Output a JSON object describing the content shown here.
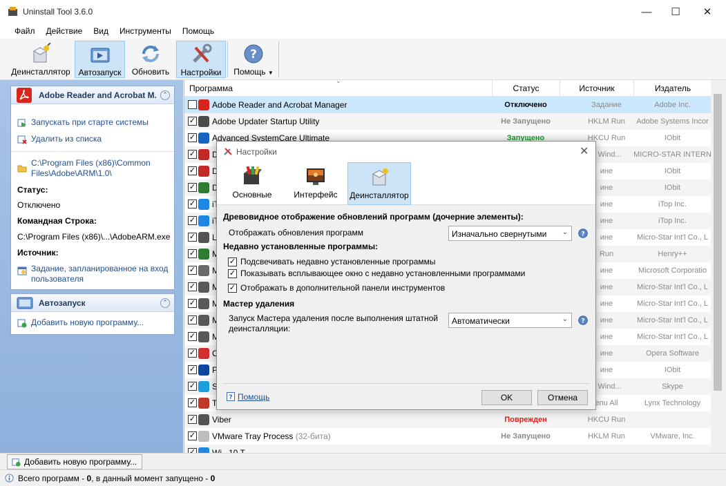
{
  "window": {
    "title": "Uninstall Tool 3.6.0"
  },
  "menu": [
    "Файл",
    "Действие",
    "Вид",
    "Инструменты",
    "Помощь"
  ],
  "toolbar": {
    "uninstaller": "Деинсталлятор",
    "autorun": "Автозапуск",
    "refresh": "Обновить",
    "settings": "Настройки",
    "help": "Помощь"
  },
  "left_panel": {
    "card1": {
      "title": "Adobe Reader and Acrobat M...",
      "run_at_startup": "Запускать при старте системы",
      "remove_from_list": "Удалить из списка",
      "path_line1": "C:\\Program Files (x86)\\Common",
      "path_line2": "Files\\Adobe\\ARM\\1.0\\",
      "status_label": "Статус:",
      "status_value": "Отключено",
      "cmd_label": "Командная Строка:",
      "cmd_value": "C:\\Program Files (x86)\\...\\AdobeARM.exe",
      "source_label": "Источник:",
      "source_line1": "Задание, запланированное на вход",
      "source_line2": "пользователя"
    },
    "card2": {
      "title": "Автозапуск",
      "add_new": "Добавить новую программу..."
    }
  },
  "grid": {
    "headers": {
      "program": "Программа",
      "status": "Статус",
      "source": "Источник",
      "publisher": "Издатель"
    },
    "rows": [
      {
        "name": "Adobe Reader and Acrobat Manager",
        "status": "Отключено",
        "source": "Задание",
        "publisher": "Adobe Inc."
      },
      {
        "name": "Adobe Updater Startup Utility",
        "status": "Не Запущено",
        "source": "HKLM Run",
        "publisher": "Adobe Systems Incor"
      },
      {
        "name": "Advanced SystemCare Ultimate",
        "status": "Запущено",
        "source": "HKCU Run",
        "publisher": "IObit"
      },
      {
        "name": "D",
        "status": "",
        "source": "a Wind...",
        "publisher": "MICRO-STAR INTERN"
      },
      {
        "name": "D",
        "status": "",
        "source": "ине",
        "publisher": "IObit"
      },
      {
        "name": "D",
        "status": "",
        "source": "ине",
        "publisher": "IObit"
      },
      {
        "name": "iT",
        "status": "",
        "source": "ине",
        "publisher": "iTop Inc."
      },
      {
        "name": "iT",
        "status": "",
        "source": "ине",
        "publisher": "iTop Inc."
      },
      {
        "name": "L",
        "status": "",
        "source": "ине",
        "publisher": "Micro-Star Int'l Co., L"
      },
      {
        "name": "M",
        "status": "",
        "source": "Run",
        "publisher": "Henry++"
      },
      {
        "name": "M",
        "status": "",
        "source": "ине",
        "publisher": "Microsoft Corporatio"
      },
      {
        "name": "M",
        "status": "",
        "source": "ине",
        "publisher": "Micro-Star Int'l Co., L"
      },
      {
        "name": "M",
        "status": "",
        "source": "ине",
        "publisher": "Micro-Star Int'l Co., L"
      },
      {
        "name": "M",
        "status": "",
        "source": "ине",
        "publisher": "Micro-Star Int'l Co., L"
      },
      {
        "name": "M",
        "status": "",
        "source": "ине",
        "publisher": "Micro-Star Int'l Co., L"
      },
      {
        "name": "O",
        "status": "",
        "source": "ине",
        "publisher": "Opera Software"
      },
      {
        "name": "P",
        "status": "",
        "source": "ине",
        "publisher": "IObit"
      },
      {
        "name": "S",
        "status": "",
        "source": "a Wind...",
        "publisher": "Skype"
      },
      {
        "name": "T",
        "status": "",
        "source": "еnu All",
        "publisher": "Lynx Technology"
      },
      {
        "name": "Viber",
        "status": "Поврежден",
        "source": "HKCU Run",
        "publisher": ""
      },
      {
        "name": "VMware Tray Process",
        "suffix": "(32-бита)",
        "status": "Не Запущено",
        "source": "HKLM Run",
        "publisher": "VMware, Inc."
      },
      {
        "name": "Wi...10 T...",
        "status": "",
        "source": "",
        "publisher": ""
      }
    ]
  },
  "bottom": {
    "add_button": "Добавить новую программу...",
    "status_prefix": "Всего программ - ",
    "total": "0",
    "status_middle": ", в данный момент запущено - ",
    "running": "0"
  },
  "dialog": {
    "title": "Настройки",
    "tabs": [
      "Основные",
      "Интерфейс",
      "Деинсталлятор"
    ],
    "section_tree": "Древовидное отображение обновлений программ (дочерние элементы):",
    "show_updates_label": "Отображать обновления программ",
    "show_updates_value": "Изначально свернутыми",
    "section_recent": "Недавно установленные программы:",
    "cb_highlight": "Подсвечивать недавно установленные программы",
    "cb_popup": "Показывать всплывающее окно с недавно установленными программами",
    "cb_extra_panel": "Отображать в дополнительной панели инструментов",
    "section_wizard": "Мастер удаления",
    "wizard_label_line1": "Запуск Мастера удаления после выполнения штатной",
    "wizard_label_line2": "деинсталляции:",
    "wizard_value": "Автоматически",
    "help_link": "Помощь",
    "ok": "OK",
    "cancel": "Отмена"
  },
  "colors": {
    "status_off": "#000000",
    "status_running": "#1aa12a",
    "status_damaged": "#e0201b",
    "selection": "#cce8ff",
    "accent": "#1f4f90"
  }
}
